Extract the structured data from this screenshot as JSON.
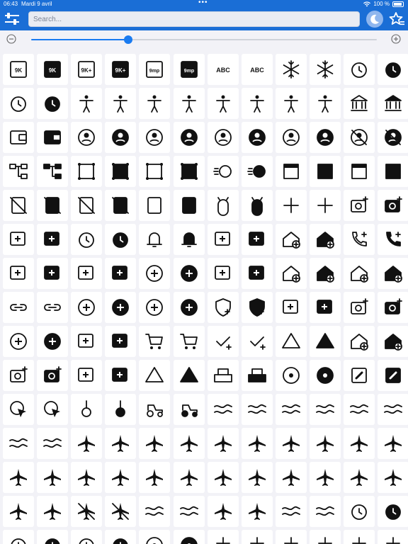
{
  "status_bar": {
    "time": "06:43",
    "date": "Mardi 9 avril",
    "battery": "100 %"
  },
  "search": {
    "placeholder": "Search..."
  },
  "zoom": {
    "value": 0.28
  },
  "colors": {
    "accent": "#1a6ed6",
    "icon": "#111111"
  },
  "icon_rows": [
    [
      "9k-icon",
      "9k-filled-icon",
      "9k-plus-icon",
      "9k-plus-filled-icon",
      "9mp-icon",
      "9mp-filled-icon",
      "abc-icon",
      "abc-filled-icon",
      "ac-unit-icon",
      "ac-unit-filled-icon",
      "access-alarm-icon",
      "access-alarm-filled-icon"
    ],
    [
      "access-time-icon",
      "access-time-filled-icon",
      "accessibility-icon",
      "accessibility-filled-icon",
      "accessibility-new-icon",
      "accessibility-new-filled-icon",
      "accessible-icon",
      "accessible-filled-icon",
      "accessible-forward-icon",
      "accessible-forward-filled-icon",
      "account-balance-icon",
      "account-balance-filled-icon"
    ],
    [
      "account-balance-wallet-icon",
      "account-balance-wallet-filled-icon",
      "account-box-icon",
      "account-box-filled-icon",
      "account-child-icon",
      "account-child-filled-icon",
      "account-child-invert-icon",
      "account-child-invert-filled-icon",
      "account-circle-icon",
      "account-circle-filled-icon",
      "account-circle-off-icon",
      "account-circle-off-filled-icon"
    ],
    [
      "account-tree-icon",
      "account-tree-filled-icon",
      "action-key-icon",
      "action-key-filled-icon",
      "activity-zone-icon",
      "activity-zone-filled-icon",
      "acute-icon",
      "acute-filled-icon",
      "ad-icon",
      "ad-filled-icon",
      "ad-group-icon",
      "ad-group-filled-icon"
    ],
    [
      "ad-off-icon",
      "ad-off-filled-icon",
      "ad-off-square-icon",
      "ad-off-square-filled-icon",
      "ad-units-icon",
      "ad-units-filled-icon",
      "adb-icon",
      "adb-filled-icon",
      "add-icon",
      "add-filled-icon",
      "add-a-photo-icon",
      "add-a-photo-filled-icon"
    ],
    [
      "add-ad-icon",
      "add-ad-filled-icon",
      "add-alarm-icon",
      "add-alarm-filled-icon",
      "add-alert-icon",
      "add-alert-filled-icon",
      "add-box-icon",
      "add-box-filled-icon",
      "add-business-icon",
      "add-business-filled-icon",
      "add-call-icon",
      "add-call-filled-icon"
    ],
    [
      "add-card-icon",
      "add-card-filled-icon",
      "add-chart-icon",
      "add-chart-filled-icon",
      "add-circle-icon",
      "add-circle-filled-icon",
      "add-comment-icon",
      "add-comment-filled-icon",
      "add-home-icon",
      "add-home-filled-icon",
      "add-home-work-icon",
      "add-home-work-filled-icon"
    ],
    [
      "add-link-icon",
      "add-link-filled-icon",
      "add-location-icon",
      "add-location-filled-icon",
      "add-location-alt-icon",
      "add-location-alt-filled-icon",
      "add-moderator-icon",
      "add-moderator-filled-icon",
      "add-notes-icon",
      "add-notes-filled-icon",
      "add-photo-alternate-icon",
      "add-photo-alternate-filled-icon"
    ],
    [
      "add-reaction-icon",
      "add-reaction-filled-icon",
      "add-road-icon",
      "add-road-filled-icon",
      "add-shopping-cart-icon",
      "add-shopping-cart-filled-icon",
      "add-task-icon",
      "add-task-filled-icon",
      "add-to-drive-icon",
      "add-to-drive-filled-icon",
      "add-to-home-screen-icon",
      "add-to-home-screen-filled-icon"
    ],
    [
      "add-to-photos-icon",
      "add-to-photos-filled-icon",
      "add-to-queue-icon",
      "add-to-queue-filled-icon",
      "add-triangle-icon",
      "add-triangle-filled-icon",
      "adf-scanner-icon",
      "adf-scanner-filled-icon",
      "adjust-icon",
      "adjust-filled-icon",
      "admin-meds-icon",
      "admin-meds-filled-icon"
    ],
    [
      "ads-click-icon",
      "ads-click-filled-icon",
      "agender-icon",
      "agender-filled-icon",
      "agriculture-icon",
      "agriculture-filled-icon",
      "air-icon",
      "air-filled-icon",
      "air-freshener-icon",
      "air-freshener-filled-icon",
      "air-purifier-icon",
      "air-purifier-filled-icon"
    ],
    [
      "air-purifier-gen-icon",
      "air-purifier-gen-filled-icon",
      "airline-seat-flat-icon",
      "airline-seat-flat-filled-icon",
      "airline-seat-flat-angled-icon",
      "airline-seat-flat-angled-filled-icon",
      "airline-seat-individual-suite-icon",
      "airline-seat-individual-suite-filled-icon",
      "airline-seat-legroom-extra-icon",
      "airline-seat-legroom-extra-filled-icon",
      "airline-seat-legroom-normal-icon",
      "airline-seat-legroom-normal-filled-icon"
    ],
    [
      "airline-seat-legroom-reduced-icon",
      "airline-seat-legroom-reduced-filled-icon",
      "airline-seat-recline-extra-icon",
      "airline-seat-recline-extra-filled-icon",
      "airline-seat-recline-normal-icon",
      "airline-seat-recline-normal-filled-icon",
      "airline-stops-icon",
      "airline-stops-filled-icon",
      "airlines-icon",
      "airlines-filled-icon",
      "airplane-ticket-icon",
      "airplane-ticket-filled-icon"
    ],
    [
      "airplanemode-active-icon",
      "airplanemode-active-filled-icon",
      "airplanemode-inactive-icon",
      "airplanemode-inactive-filled-icon",
      "airplay-icon",
      "airplay-filled-icon",
      "airport-shuttle-icon",
      "airport-shuttle-filled-icon",
      "airwave-icon",
      "airwave-filled-icon",
      "alarm-off-icon",
      "alarm-off-filled-icon"
    ],
    [
      "alarm-on-icon",
      "alarm-on-filled-icon",
      "alarm-pause-icon",
      "alarm-pause-filled-icon",
      "album-icon",
      "album-filled-icon",
      "align-center-icon",
      "align-center-filled-icon",
      "align-end-icon",
      "align-end-filled-icon",
      "align-flex-center-icon",
      "align-flex-center-filled-icon"
    ]
  ]
}
